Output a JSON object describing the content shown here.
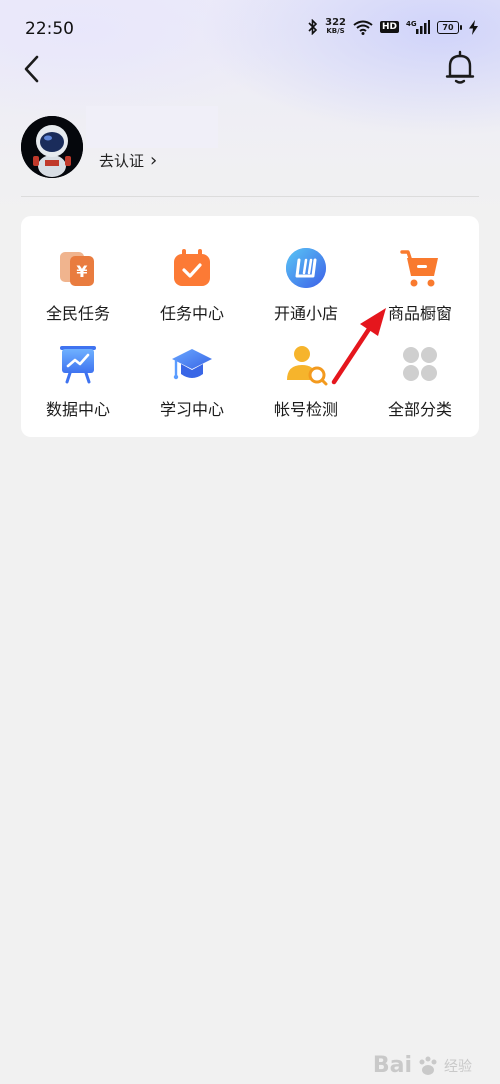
{
  "status_bar": {
    "time": "22:50",
    "net_speed_value": "322",
    "net_speed_unit": "KB/S",
    "hd_label": "HD",
    "network_label": "4G",
    "battery": "70"
  },
  "header": {
    "back_icon": "chevron-left-icon",
    "bell_icon": "bell-icon"
  },
  "profile": {
    "verify_label": "去认证",
    "verify_chevron": "›"
  },
  "menu": {
    "items": [
      {
        "label": "全民任务",
        "icon": "yuan-cards-icon"
      },
      {
        "label": "任务中心",
        "icon": "calendar-check-icon"
      },
      {
        "label": "开通小店",
        "icon": "shop-logo-icon"
      },
      {
        "label": "商品橱窗",
        "icon": "cart-icon"
      },
      {
        "label": "数据中心",
        "icon": "data-board-icon"
      },
      {
        "label": "学习中心",
        "icon": "grad-cap-icon"
      },
      {
        "label": "帐号检测",
        "icon": "user-search-icon"
      },
      {
        "label": "全部分类",
        "icon": "grid-icon"
      }
    ]
  },
  "watermark": {
    "brand": "Bai",
    "suffix": "经验"
  },
  "colors": {
    "accent_orange": "#f97a2e",
    "arrow_red": "#e5161d",
    "card_bg": "#ffffff",
    "page_bg": "#f1f1f1"
  }
}
